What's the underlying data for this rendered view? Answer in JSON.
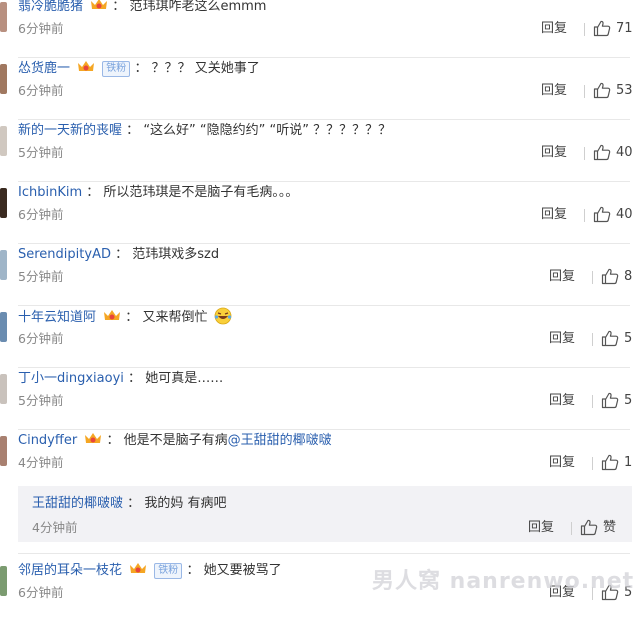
{
  "comments": [
    {
      "user": "翡冷脆脆猪",
      "text": "范玮琪咋老这么emmm",
      "time": "6分钟前",
      "reply": "回复",
      "likes": "71",
      "crown": true,
      "badge": ""
    },
    {
      "user": "怂货鹿一",
      "text": "？？？ 又关她事了",
      "time": "6分钟前",
      "reply": "回复",
      "likes": "53",
      "crown": true,
      "badge": "铁粉"
    },
    {
      "user": "新的一天新的丧喔",
      "text": "“这么好” “隐隐约约” “听说” ？？？？？？",
      "time": "5分钟前",
      "reply": "回复",
      "likes": "40",
      "crown": false,
      "badge": ""
    },
    {
      "user": "IchbinKim",
      "text": "所以范玮琪是不是脑子有毛病。。。",
      "time": "6分钟前",
      "reply": "回复",
      "likes": "40",
      "crown": false,
      "badge": ""
    },
    {
      "user": "SerendipityAD",
      "text": "范玮琪戏多szd",
      "time": "5分钟前",
      "reply": "回复",
      "likes": "8",
      "crown": false,
      "badge": ""
    },
    {
      "user": "十年云知道阿",
      "text": "又来帮倒忙",
      "time": "6分钟前",
      "reply": "回复",
      "likes": "5",
      "crown": true,
      "badge": ""
    },
    {
      "user": "丁小一dingxiaoyi",
      "text": "她可真是……",
      "time": "5分钟前",
      "reply": "回复",
      "likes": "5",
      "crown": false,
      "badge": ""
    },
    {
      "user": "Cindyffer",
      "text": "他是不是脑子有病",
      "mention": "@王甜甜的椰啵啵",
      "time": "4分钟前",
      "reply": "回复",
      "likes": "1",
      "crown": true,
      "badge": ""
    },
    {
      "user": "邻居的耳朵一枝花",
      "text": "她又要被骂了",
      "time": "6分钟前",
      "reply": "回复",
      "likes": "5",
      "crown": true,
      "badge": "铁粉"
    }
  ],
  "subreply": {
    "user": "王甜甜的椰啵啵",
    "text": "我的妈 有病吧",
    "time": "4分钟前",
    "reply": "回复",
    "like_label": "赞"
  },
  "watermark": "男人窝 nanrenwo.net",
  "colors": {
    "username": "#2a5fae",
    "accent_badge": "#7aa3dd",
    "divider": "#e8e8e8"
  }
}
